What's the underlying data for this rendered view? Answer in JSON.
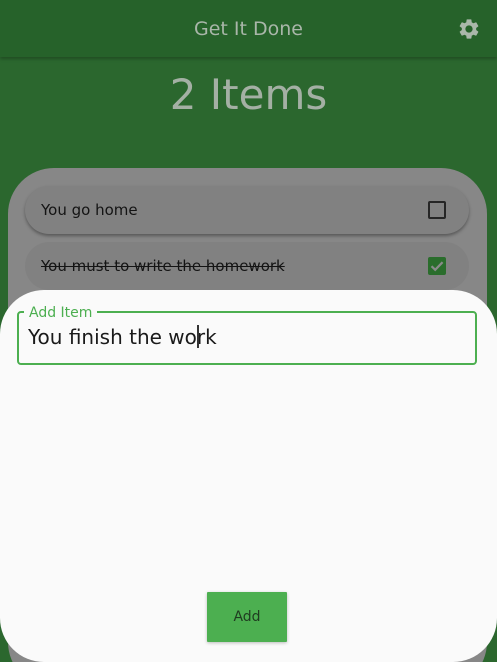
{
  "app": {
    "title": "Get It Done",
    "settings_icon": "gear-icon"
  },
  "summary": {
    "count_label": "2 Items"
  },
  "todos": [
    {
      "text": "You go home",
      "done": false
    },
    {
      "text": "You must to write the homework",
      "done": true
    }
  ],
  "add_sheet": {
    "field_label": "Add Item",
    "field_value": "You finish the work",
    "button_label": "Add"
  },
  "colors": {
    "primary": "#4caf50",
    "appbar_dimmed": "#26622a",
    "background_dimmed": "#2b672e"
  }
}
